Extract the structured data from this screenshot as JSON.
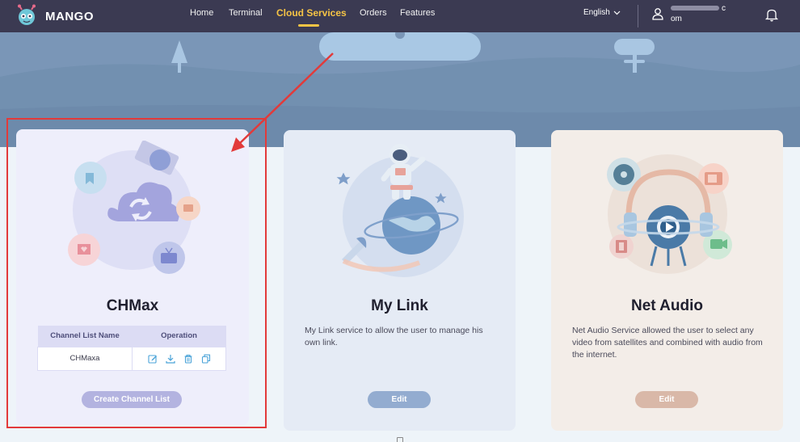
{
  "brand": {
    "name": "MANGO"
  },
  "nav": {
    "items": [
      {
        "label": "Home",
        "active": false
      },
      {
        "label": "Terminal",
        "active": false
      },
      {
        "label": "Cloud Services",
        "active": true
      },
      {
        "label": "Orders",
        "active": false
      },
      {
        "label": "Features",
        "active": false
      }
    ]
  },
  "header": {
    "language": "English",
    "user_email_end": "c",
    "user_email_line2": "om"
  },
  "cards": {
    "chmax": {
      "title": "CHMax",
      "table": {
        "headers": [
          "Channel List Name",
          "Operation"
        ],
        "rows": [
          {
            "name": "CHMaxa"
          }
        ]
      },
      "operations": [
        "edit-icon",
        "download-icon",
        "delete-icon",
        "copy-icon"
      ],
      "button": "Create Channel List"
    },
    "mylink": {
      "title": "My Link",
      "description": "My Link service to allow the user to manage his own link.",
      "button": "Edit"
    },
    "netaudio": {
      "title": "Net Audio",
      "description": "Net Audio Service allowed the user to select any video from satellites and combined with audio from the internet.",
      "button": "Edit"
    }
  },
  "colors": {
    "nav_bg": "#3b3a52",
    "accent": "#f6c445",
    "annotation": "#e23a3a"
  }
}
